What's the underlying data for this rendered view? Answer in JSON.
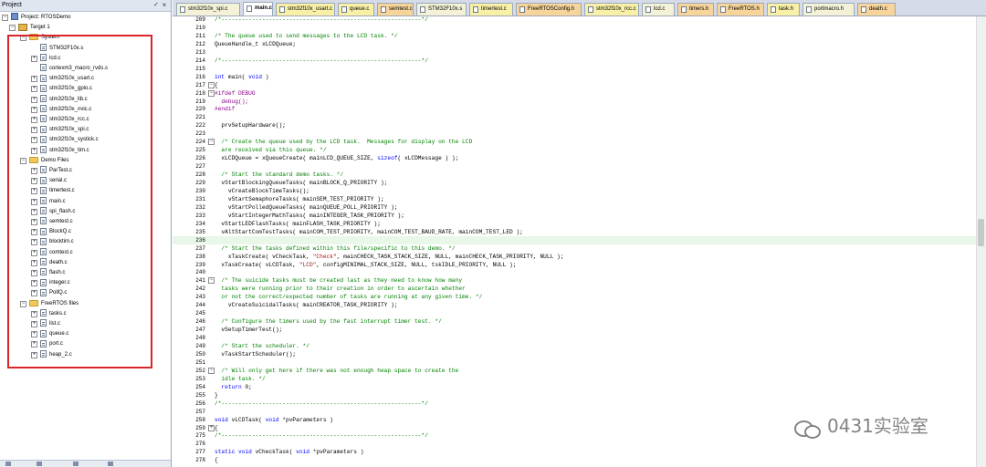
{
  "project": {
    "title": "Project",
    "pin": "✓",
    "close": "×",
    "tree": [
      {
        "label": "Project: RTOSDemo",
        "level": 0,
        "kind": "project",
        "exp": "−"
      },
      {
        "label": "Target 1",
        "level": 1,
        "kind": "target",
        "exp": "−"
      },
      {
        "label": "System",
        "level": 2,
        "kind": "folder",
        "exp": "−"
      },
      {
        "label": "STM32F10x.s",
        "level": 3,
        "kind": "file",
        "exp": ""
      },
      {
        "label": "lcd.c",
        "level": 3,
        "kind": "file",
        "exp": "+"
      },
      {
        "label": "cortexm3_macro_rvds.s",
        "level": 3,
        "kind": "file",
        "exp": ""
      },
      {
        "label": "stm32f10x_usart.c",
        "level": 3,
        "kind": "file",
        "exp": "+"
      },
      {
        "label": "stm32f10x_gpio.c",
        "level": 3,
        "kind": "file",
        "exp": "+"
      },
      {
        "label": "stm32f10x_lib.c",
        "level": 3,
        "kind": "file",
        "exp": "+"
      },
      {
        "label": "stm32f10x_nvic.c",
        "level": 3,
        "kind": "file",
        "exp": "+"
      },
      {
        "label": "stm32f10x_rcc.c",
        "level": 3,
        "kind": "file",
        "exp": "+"
      },
      {
        "label": "stm32f10x_spi.c",
        "level": 3,
        "kind": "file",
        "exp": "+"
      },
      {
        "label": "stm32f10x_systick.c",
        "level": 3,
        "kind": "file",
        "exp": "+"
      },
      {
        "label": "stm32f10x_tim.c",
        "level": 3,
        "kind": "file",
        "exp": "+"
      },
      {
        "label": "Demo Files",
        "level": 2,
        "kind": "folder",
        "exp": "−"
      },
      {
        "label": "ParTest.c",
        "level": 3,
        "kind": "file",
        "exp": "+"
      },
      {
        "label": "serial.c",
        "level": 3,
        "kind": "file",
        "exp": "+"
      },
      {
        "label": "timertest.c",
        "level": 3,
        "kind": "file",
        "exp": "+"
      },
      {
        "label": "main.c",
        "level": 3,
        "kind": "file",
        "exp": "+"
      },
      {
        "label": "spi_flash.c",
        "level": 3,
        "kind": "file",
        "exp": "+"
      },
      {
        "label": "semtest.c",
        "level": 3,
        "kind": "file",
        "exp": "+"
      },
      {
        "label": "BlockQ.c",
        "level": 3,
        "kind": "file",
        "exp": "+"
      },
      {
        "label": "blocktim.c",
        "level": 3,
        "kind": "file",
        "exp": "+"
      },
      {
        "label": "comtest.c",
        "level": 3,
        "kind": "file",
        "exp": "+"
      },
      {
        "label": "death.c",
        "level": 3,
        "kind": "file",
        "exp": "+"
      },
      {
        "label": "flash.c",
        "level": 3,
        "kind": "file",
        "exp": "+"
      },
      {
        "label": "integer.c",
        "level": 3,
        "kind": "file",
        "exp": "+"
      },
      {
        "label": "PollQ.c",
        "level": 3,
        "kind": "file",
        "exp": "+"
      },
      {
        "label": "FreeRTOS files",
        "level": 2,
        "kind": "folder",
        "exp": "−"
      },
      {
        "label": "tasks.c",
        "level": 3,
        "kind": "file",
        "exp": "+"
      },
      {
        "label": "list.c",
        "level": 3,
        "kind": "file",
        "exp": "+"
      },
      {
        "label": "queue.c",
        "level": 3,
        "kind": "file",
        "exp": "+"
      },
      {
        "label": "port.c",
        "level": 3,
        "kind": "file",
        "exp": "+"
      },
      {
        "label": "heap_2.c",
        "level": 3,
        "kind": "file",
        "exp": "+"
      }
    ]
  },
  "tabs": [
    {
      "label": "stm32f10x_spi.c",
      "style": "normal",
      "active": false
    },
    {
      "label": "main.c",
      "style": "normal",
      "active": true
    },
    {
      "label": "stm32f10x_usart.c",
      "style": "y",
      "active": false
    },
    {
      "label": "queue.c",
      "style": "y",
      "active": false
    },
    {
      "label": "semtest.c",
      "style": "o",
      "active": false
    },
    {
      "label": "STM32F10x.s",
      "style": "normal",
      "active": false
    },
    {
      "label": "timertest.c",
      "style": "y",
      "active": false
    },
    {
      "label": "FreeRTOSConfig.h",
      "style": "o",
      "active": false
    },
    {
      "label": "stm32f10x_rcc.c",
      "style": "y",
      "active": false
    },
    {
      "label": "lcd.c",
      "style": "normal",
      "active": false
    },
    {
      "label": "timers.h",
      "style": "o",
      "active": false
    },
    {
      "label": "FreeRTOS.h",
      "style": "o",
      "active": false
    },
    {
      "label": "task.h",
      "style": "y",
      "active": false
    },
    {
      "label": "portmacro.h",
      "style": "normal",
      "active": false
    },
    {
      "label": "death.c",
      "style": "o",
      "active": false
    }
  ],
  "code": [
    {
      "n": "209",
      "fold": "",
      "segs": [
        [
          "cm",
          "/*-----------------------------------------------------------*/"
        ]
      ]
    },
    {
      "n": "210",
      "fold": "",
      "segs": []
    },
    {
      "n": "211",
      "fold": "",
      "segs": [
        [
          "cm",
          "/* The queue used to send messages to the LCD task. */"
        ]
      ]
    },
    {
      "n": "212",
      "fold": "",
      "segs": [
        [
          "pl",
          "QueueHandle_t xLCDQueue;"
        ]
      ]
    },
    {
      "n": "213",
      "fold": "",
      "segs": []
    },
    {
      "n": "214",
      "fold": "",
      "segs": [
        [
          "cm",
          "/*-----------------------------------------------------------*/"
        ]
      ]
    },
    {
      "n": "215",
      "fold": "",
      "segs": []
    },
    {
      "n": "216",
      "fold": "",
      "segs": [
        [
          "kw",
          "int"
        ],
        [
          "pl",
          " main( "
        ],
        [
          "kw",
          "void"
        ],
        [
          "pl",
          " )"
        ]
      ]
    },
    {
      "n": "217",
      "fold": "−",
      "segs": [
        [
          "pl",
          "{"
        ]
      ]
    },
    {
      "n": "218",
      "fold": "−",
      "segs": [
        [
          "pp",
          "#ifdef DEBUG"
        ]
      ]
    },
    {
      "n": "219",
      "fold": "",
      "segs": [
        [
          "pp",
          "  debug();"
        ]
      ]
    },
    {
      "n": "220",
      "fold": "",
      "segs": [
        [
          "pp",
          "#endif"
        ]
      ]
    },
    {
      "n": "221",
      "fold": "",
      "segs": []
    },
    {
      "n": "222",
      "fold": "",
      "segs": [
        [
          "pl",
          "  prvSetupHardware();"
        ]
      ]
    },
    {
      "n": "223",
      "fold": "",
      "segs": []
    },
    {
      "n": "224",
      "fold": "−",
      "segs": [
        [
          "cm",
          "  /* Create the queue used by the LCD task.  Messages for display on the LCD"
        ]
      ]
    },
    {
      "n": "225",
      "fold": "",
      "segs": [
        [
          "cm",
          "  are received via this queue. */"
        ]
      ]
    },
    {
      "n": "226",
      "fold": "",
      "segs": [
        [
          "pl",
          "  xLCDQueue = xQueueCreate( mainLCD_QUEUE_SIZE, "
        ],
        [
          "kw",
          "sizeof"
        ],
        [
          "pl",
          "( xLCDMessage ) );"
        ]
      ]
    },
    {
      "n": "227",
      "fold": "",
      "segs": []
    },
    {
      "n": "228",
      "fold": "",
      "segs": [
        [
          "cm",
          "  /* Start the standard demo tasks. */"
        ]
      ]
    },
    {
      "n": "229",
      "fold": "",
      "segs": [
        [
          "pl",
          "  vStartBlockingQueueTasks( mainBLOCK_Q_PRIORITY );"
        ]
      ]
    },
    {
      "n": "230",
      "fold": "",
      "segs": [
        [
          "pl",
          "    vCreateBlockTimeTasks();"
        ]
      ]
    },
    {
      "n": "231",
      "fold": "",
      "segs": [
        [
          "pl",
          "    vStartSemaphoreTasks( mainSEM_TEST_PRIORITY );"
        ]
      ]
    },
    {
      "n": "232",
      "fold": "",
      "segs": [
        [
          "pl",
          "    vStartPolledQueueTasks( mainQUEUE_POLL_PRIORITY );"
        ]
      ]
    },
    {
      "n": "233",
      "fold": "",
      "segs": [
        [
          "pl",
          "    vStartIntegerMathTasks( mainINTEGER_TASK_PRIORITY );"
        ]
      ]
    },
    {
      "n": "234",
      "fold": "",
      "segs": [
        [
          "pl",
          "  vStartLEDFlashTasks( mainFLASH_TASK_PRIORITY );"
        ]
      ]
    },
    {
      "n": "235",
      "fold": "",
      "segs": [
        [
          "pl",
          "  vAltStartComTestTasks( mainCOM_TEST_PRIORITY, mainCOM_TEST_BAUD_RATE, mainCOM_TEST_LED );"
        ]
      ]
    },
    {
      "n": "236",
      "fold": "",
      "segs": [],
      "hl": true
    },
    {
      "n": "237",
      "fold": "",
      "segs": [
        [
          "cm",
          "  /* Start the tasks defined within this file/specific to this demo. */"
        ]
      ]
    },
    {
      "n": "238",
      "fold": "",
      "segs": [
        [
          "pl",
          "    xTaskCreate( vCheckTask, "
        ],
        [
          "st",
          "\"Check\""
        ],
        [
          "pl",
          ", mainCHECK_TASK_STACK_SIZE, NULL, mainCHECK_TASK_PRIORITY, NULL );"
        ]
      ]
    },
    {
      "n": "239",
      "fold": "",
      "segs": [
        [
          "pl",
          "  xTaskCreate( vLCDTask, "
        ],
        [
          "st",
          "\"LCD\""
        ],
        [
          "pl",
          ", configMINIMAL_STACK_SIZE, NULL, tskIDLE_PRIORITY, NULL );"
        ]
      ]
    },
    {
      "n": "240",
      "fold": "",
      "segs": []
    },
    {
      "n": "241",
      "fold": "−",
      "segs": [
        [
          "cm",
          "  /* The suicide tasks must be created last as they need to know how many"
        ]
      ]
    },
    {
      "n": "242",
      "fold": "",
      "segs": [
        [
          "cm",
          "  tasks were running prior to their creation in order to ascertain whether"
        ]
      ]
    },
    {
      "n": "243",
      "fold": "",
      "segs": [
        [
          "cm",
          "  or not the correct/expected number of tasks are running at any given time. */"
        ]
      ]
    },
    {
      "n": "244",
      "fold": "",
      "segs": [
        [
          "pl",
          "    vCreateSuicidalTasks( mainCREATOR_TASK_PRIORITY );"
        ]
      ]
    },
    {
      "n": "245",
      "fold": "",
      "segs": []
    },
    {
      "n": "246",
      "fold": "",
      "segs": [
        [
          "cm",
          "  /* Configure the timers used by the fast interrupt timer test. */"
        ]
      ]
    },
    {
      "n": "247",
      "fold": "",
      "segs": [
        [
          "pl",
          "  vSetupTimerTest();"
        ]
      ]
    },
    {
      "n": "248",
      "fold": "",
      "segs": []
    },
    {
      "n": "249",
      "fold": "",
      "segs": [
        [
          "cm",
          "  /* Start the scheduler. */"
        ]
      ]
    },
    {
      "n": "250",
      "fold": "",
      "segs": [
        [
          "pl",
          "  vTaskStartScheduler();"
        ]
      ]
    },
    {
      "n": "251",
      "fold": "",
      "segs": []
    },
    {
      "n": "252",
      "fold": "−",
      "segs": [
        [
          "cm",
          "  /* Will only get here if there was not enough heap space to create the"
        ]
      ]
    },
    {
      "n": "253",
      "fold": "",
      "segs": [
        [
          "cm",
          "  idle task. */"
        ]
      ]
    },
    {
      "n": "254",
      "fold": "",
      "segs": [
        [
          "kw",
          "  return"
        ],
        [
          "pl",
          " 0;"
        ]
      ]
    },
    {
      "n": "255",
      "fold": "",
      "segs": [
        [
          "pl",
          "}"
        ]
      ]
    },
    {
      "n": "256",
      "fold": "",
      "segs": [
        [
          "cm",
          "/*-----------------------------------------------------------*/"
        ]
      ]
    },
    {
      "n": "257",
      "fold": "",
      "segs": []
    },
    {
      "n": "258",
      "fold": "",
      "segs": [
        [
          "kw",
          "void"
        ],
        [
          "pl",
          " vLCDTask( "
        ],
        [
          "kw",
          "void"
        ],
        [
          "pl",
          " *pvParameters )"
        ]
      ]
    },
    {
      "n": "259",
      "fold": "+",
      "segs": [
        [
          "pl",
          "{"
        ]
      ]
    },
    {
      "n": "275",
      "fold": "",
      "segs": [
        [
          "cm",
          "/*-----------------------------------------------------------*/"
        ]
      ]
    },
    {
      "n": "276",
      "fold": "",
      "segs": []
    },
    {
      "n": "277",
      "fold": "",
      "segs": [
        [
          "kw",
          "static void"
        ],
        [
          "pl",
          " vCheckTask( "
        ],
        [
          "kw",
          "void"
        ],
        [
          "pl",
          " *pvParameters )"
        ]
      ]
    },
    {
      "n": "278",
      "fold": "",
      "segs": [
        [
          "pl",
          "{"
        ]
      ]
    }
  ],
  "watermark": "0431实验室",
  "colors": {
    "highlight": "#d9262b",
    "comment": "#008000",
    "keyword": "#0000ff",
    "string": "#a31515",
    "preprocessor": "#8b008b"
  }
}
